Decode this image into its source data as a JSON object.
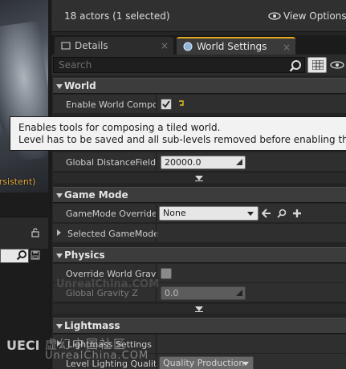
{
  "left_pane": {
    "persistent_label": "ersistent)"
  },
  "outliner": {
    "actor_count": "18 actors (1 selected)",
    "view_options": "View Options"
  },
  "tabs": [
    {
      "label": "Details",
      "active": false
    },
    {
      "label": "World Settings",
      "active": true
    }
  ],
  "search": {
    "placeholder": "Search"
  },
  "sections": {
    "world": {
      "title": "World",
      "enable_world_composition_label": "Enable World Compos",
      "enable_world_composition_checked": true,
      "global_distancefield_label": "Global DistanceField \\",
      "global_distancefield_value": "20000.0"
    },
    "game_mode": {
      "title": "Game Mode",
      "gamemode_override_label": "GameMode Override",
      "gamemode_override_value": "None",
      "selected_gamemode_label": "Selected GameMode"
    },
    "physics": {
      "title": "Physics",
      "override_world_gravity_label": "Override World Gravity",
      "override_world_gravity_checked": false,
      "global_gravity_z_label": "Global Gravity Z",
      "global_gravity_z_value": "0.0"
    },
    "lightmass": {
      "title": "Lightmass",
      "lightmass_settings_label": "Lightmass Settings",
      "level_lighting_quality_label": "Level Lighting Quality",
      "level_lighting_quality_value": "Quality Production"
    }
  },
  "tooltip": {
    "line1": "Enables tools for composing a tiled world.",
    "line2": "Level has to be saved and all sub-levels removed before enabling this option."
  },
  "watermark": {
    "faint": "UnrealChina.COM",
    "cn": "虚幻中国社区",
    "en": "UnrealChina.COM",
    "logo": "UECN"
  },
  "colors": {
    "accent": "#e2a61d",
    "panel": "#2f2f2f",
    "header": "#3c3c3c",
    "tooltip_bg": "#f2f2f2"
  },
  "icons": [
    "lock-icon",
    "search-icon",
    "save-icon",
    "eye-icon",
    "world-icon",
    "grid-view-icon",
    "arrow-left-icon",
    "magnifier-icon",
    "plus-icon",
    "reset-arrow-icon"
  ]
}
